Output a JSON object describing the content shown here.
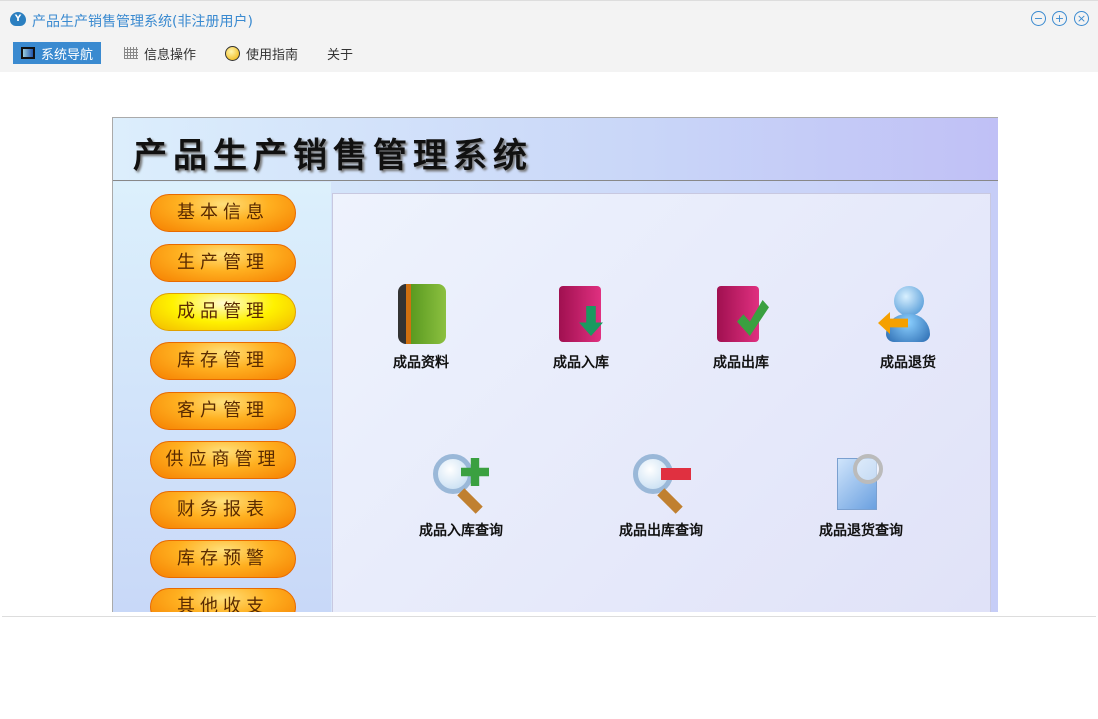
{
  "window": {
    "title": "产品生产销售管理系统(非注册用户)",
    "controls": [
      "minimize",
      "maximize",
      "close"
    ]
  },
  "menu": [
    {
      "label": "系统导航",
      "icon": "monitor-icon",
      "active": true
    },
    {
      "label": "信息操作",
      "icon": "grid-icon"
    },
    {
      "label": "使用指南",
      "icon": "help-icon"
    },
    {
      "label": "关于"
    }
  ],
  "header": {
    "title": "产品生产销售管理系统"
  },
  "sidebar": [
    {
      "label": "基本信息"
    },
    {
      "label": "生产管理"
    },
    {
      "label": "成品管理",
      "selected": true
    },
    {
      "label": "库存管理"
    },
    {
      "label": "客户管理"
    },
    {
      "label": "供应商管理"
    },
    {
      "label": "财务报表"
    },
    {
      "label": "库存预警"
    },
    {
      "label": "其他收支"
    }
  ],
  "functions": [
    {
      "label": "成品资料",
      "icon": "book-icon"
    },
    {
      "label": "成品入库",
      "icon": "folder-in-icon"
    },
    {
      "label": "成品出库",
      "icon": "folder-out-icon"
    },
    {
      "label": "成品退货",
      "icon": "user-return-icon"
    },
    {
      "label": "成品入库查询",
      "icon": "search-plus-icon"
    },
    {
      "label": "成品出库查询",
      "icon": "search-minus-icon"
    },
    {
      "label": "成品退货查询",
      "icon": "document-search-icon"
    }
  ]
}
